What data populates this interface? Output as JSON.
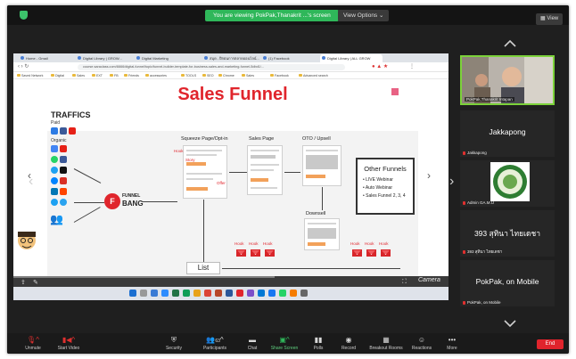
{
  "banner": {
    "viewing_text": "You are viewing PokPak,Thanakrit ...'s screen",
    "view_options": "View Options",
    "view_button": "View"
  },
  "browser": {
    "tabs": [
      "Home - Gmail",
      "Digital Library | GROW...",
      "Digital Marketing",
      "สมุด - ฝึกฝนการตลาดออนไลน์...",
      "(1) Facebook",
      "Digital Library | ALL GROW"
    ],
    "address": "course.saraclass.com/6666/digital-funnel/topic/funnel-builder-template-for-business-sales-and-marketing-funnel-5dbd1/...",
    "bookmarks": [
      "Saved Network",
      "Digital",
      "Sales",
      "EXT",
      "FB",
      "Friends",
      "accessories",
      "TOOLS",
      "SEO",
      "Chrome",
      "Sales",
      "Facebook",
      "Advanced search"
    ]
  },
  "slide": {
    "title": "Sales Funnel",
    "traffics": "TRAFFICS",
    "paid": "Paid",
    "organic": "Organic",
    "funnel_label": "FUNNEL",
    "funnel_name": "BANG",
    "squeeze": "Squeeze Page/Opt-in",
    "sales_page": "Sales Page",
    "oto": "OTO / Upsell",
    "downsell": "Downsell",
    "hook": "Hook",
    "story": "Story",
    "offer": "Offer",
    "list": "List",
    "other_funnels": {
      "title": "Other Funnels",
      "items": [
        "• LIVE Webinar",
        "• Auto Webinar",
        "• Sales Funnel 2, 3, 4"
      ]
    }
  },
  "share_bar": {
    "camera_label": "Camera"
  },
  "participants": [
    {
      "name": "",
      "footer": "PokPak,Thanakrit Intapan",
      "type": "video"
    },
    {
      "name": "Jakkapong",
      "footer": "Jakkapong",
      "type": "name"
    },
    {
      "name": "",
      "footer": "Admin GA.M.U",
      "type": "logo"
    },
    {
      "name": "393 สุทินา ไทยเดชา",
      "footer": "393 สุทินา ไทยเดชา",
      "type": "name"
    },
    {
      "name": "PokPak, on Mobile",
      "footer": "PokPak, on Mobile",
      "type": "name"
    }
  ],
  "toolbar": {
    "unmute": "Unmute",
    "start_video": "Start Video",
    "security": "Security",
    "participants": "Participants",
    "participants_count": "63",
    "chat": "Chat",
    "share_screen": "Share Screen",
    "polls": "Polls",
    "record": "Record",
    "breakout": "Breakout Rooms",
    "reactions": "Reactions",
    "more": "More",
    "end": "End"
  },
  "colors": {
    "accent_green": "#2fb75a",
    "end_red": "#e0242c",
    "funnel_red": "#e0252c",
    "active_speaker": "#7cd23a"
  }
}
